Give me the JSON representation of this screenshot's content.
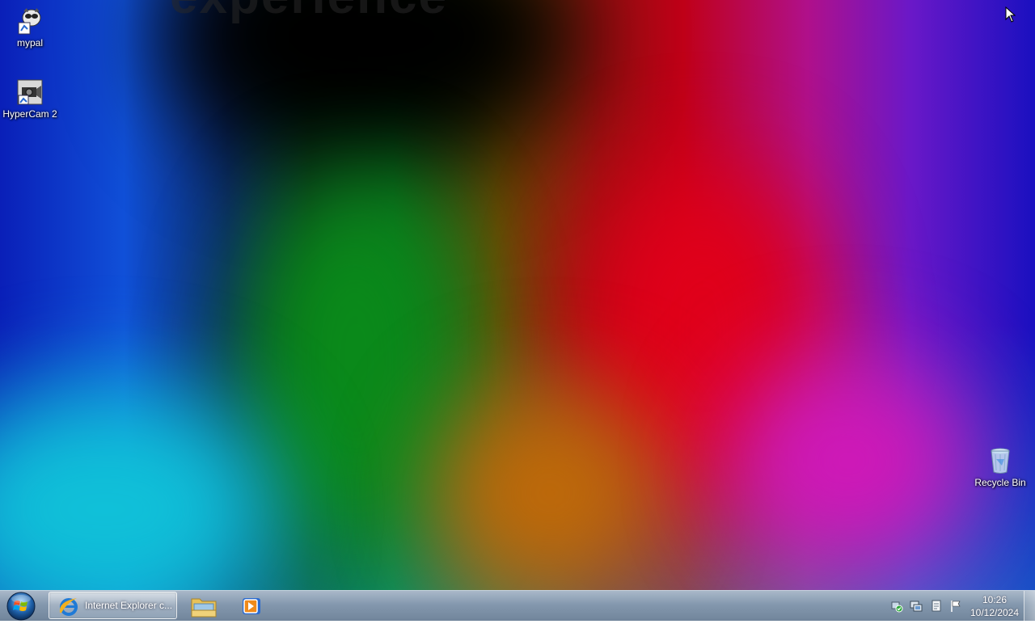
{
  "desktop": {
    "wallpaper_watermark": "experience",
    "icons": [
      {
        "label": "mypal",
        "icon": "mypal-browser-icon"
      },
      {
        "label": "HyperCam 2",
        "icon": "hypercam-icon"
      },
      {
        "label": "Recycle Bin",
        "icon": "recycle-bin-icon"
      }
    ]
  },
  "taskbar": {
    "start_icon": "windows-start-orb",
    "buttons": [
      {
        "label": "Internet Explorer c...",
        "icon": "internet-explorer-icon",
        "active": true
      },
      {
        "label": "",
        "icon": "windows-explorer-folder-icon",
        "active": false
      },
      {
        "label": "",
        "icon": "media-player-icon",
        "active": false
      }
    ],
    "tray": {
      "icons": [
        "security-shield-icon",
        "network-icon",
        "document-icon",
        "action-center-flag-icon"
      ],
      "time": "10:26",
      "date": "10/12/2024"
    }
  },
  "colors": {
    "taskbar_top": "#a9b8c9",
    "taskbar_bottom": "#71859b",
    "label_text": "#ffffff"
  }
}
